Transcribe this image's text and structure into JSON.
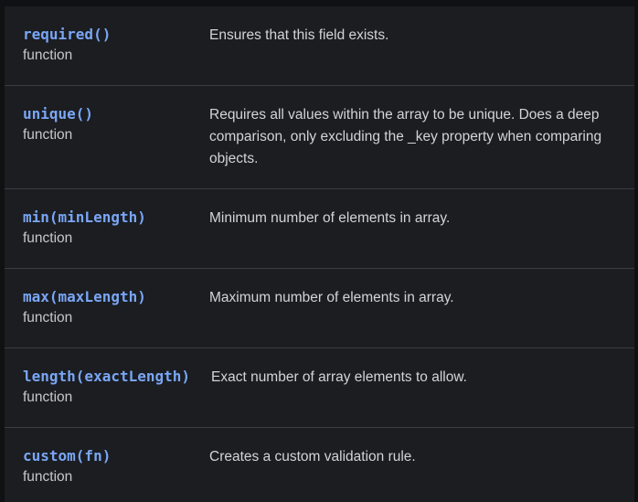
{
  "rules": [
    {
      "name": "required()",
      "type": "function",
      "description": "Ensures that this field exists."
    },
    {
      "name": "unique()",
      "type": "function",
      "description": "Requires all values within the array to be unique. Does a deep comparison, only excluding the _key property when comparing objects."
    },
    {
      "name": "min(minLength)",
      "type": "function",
      "description": "Minimum number of elements in array."
    },
    {
      "name": "max(maxLength)",
      "type": "function",
      "description": "Maximum number of elements in array."
    },
    {
      "name": "length(exactLength)",
      "type": "function",
      "description": "Exact number of array elements to allow."
    },
    {
      "name": "custom(fn)",
      "type": "function",
      "description": "Creates a custom validation rule."
    }
  ]
}
